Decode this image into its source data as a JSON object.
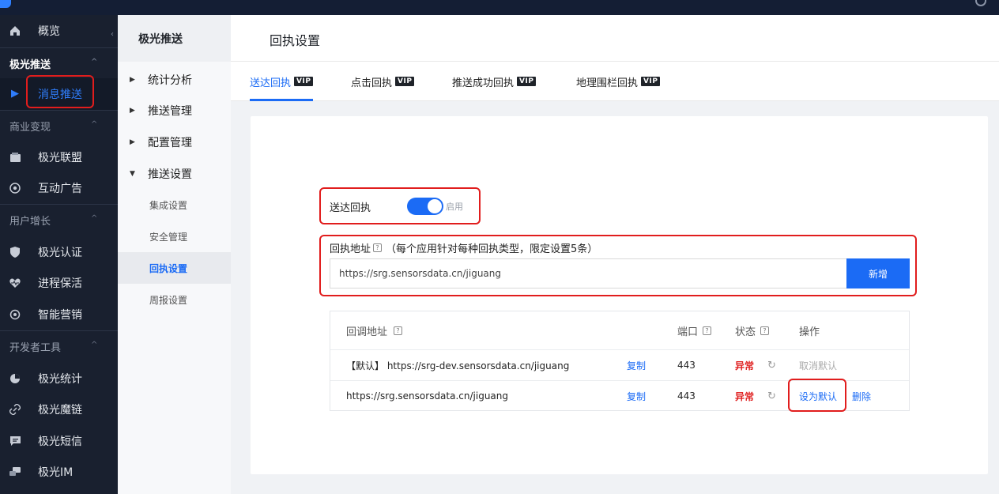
{
  "sidebar": {
    "overview": "概览",
    "groups": {
      "push": "极光推送",
      "monetize": "商业变现",
      "growth": "用户增长",
      "devtools": "开发者工具"
    },
    "items": {
      "message_push": "消息推送",
      "alliance": "极光联盟",
      "interactive_ads": "互动广告",
      "verification": "极光认证",
      "keepalive": "进程保活",
      "smart_marketing": "智能营销",
      "analytics": "极光统计",
      "magic_link": "极光魔链",
      "sms": "极光短信",
      "im": "极光IM"
    }
  },
  "subnav": {
    "title": "极光推送",
    "items": [
      "统计分析",
      "推送管理",
      "配置管理",
      "推送设置"
    ],
    "sub_items": [
      "集成设置",
      "安全管理",
      "回执设置",
      "周报设置"
    ]
  },
  "page": {
    "title": "回执设置"
  },
  "tabs": {
    "vip": "VIP",
    "items": [
      "送达回执",
      "点击回执",
      "推送成功回执",
      "地理围栏回执"
    ]
  },
  "receipt": {
    "toggle_label": "送达回执",
    "toggle_state": "启用",
    "address_label": "回执地址",
    "address_note": "（每个应用针对每种回执类型，限定设置5条）",
    "address_input_value": "https://srg.sensorsdata.cn/jiguang",
    "add_button": "新增"
  },
  "table": {
    "headers": {
      "url": "回调地址",
      "port": "端口",
      "status": "状态",
      "actions": "操作"
    },
    "help_glyph": "?",
    "rows": [
      {
        "url": "【默认】 https://srg-dev.sensorsdata.cn/jiguang",
        "copy": "复制",
        "port": "443",
        "status": "异常",
        "action1": "取消默认",
        "action2": ""
      },
      {
        "url": "https://srg.sensorsdata.cn/jiguang",
        "copy": "复制",
        "port": "443",
        "status": "异常",
        "action1": "设为默认",
        "action2": "删除"
      }
    ]
  },
  "colors": {
    "accent": "#1b6bf5",
    "sidebar_bg": "#19202f",
    "error": "#e02424",
    "highlight": "#e11d1d"
  }
}
